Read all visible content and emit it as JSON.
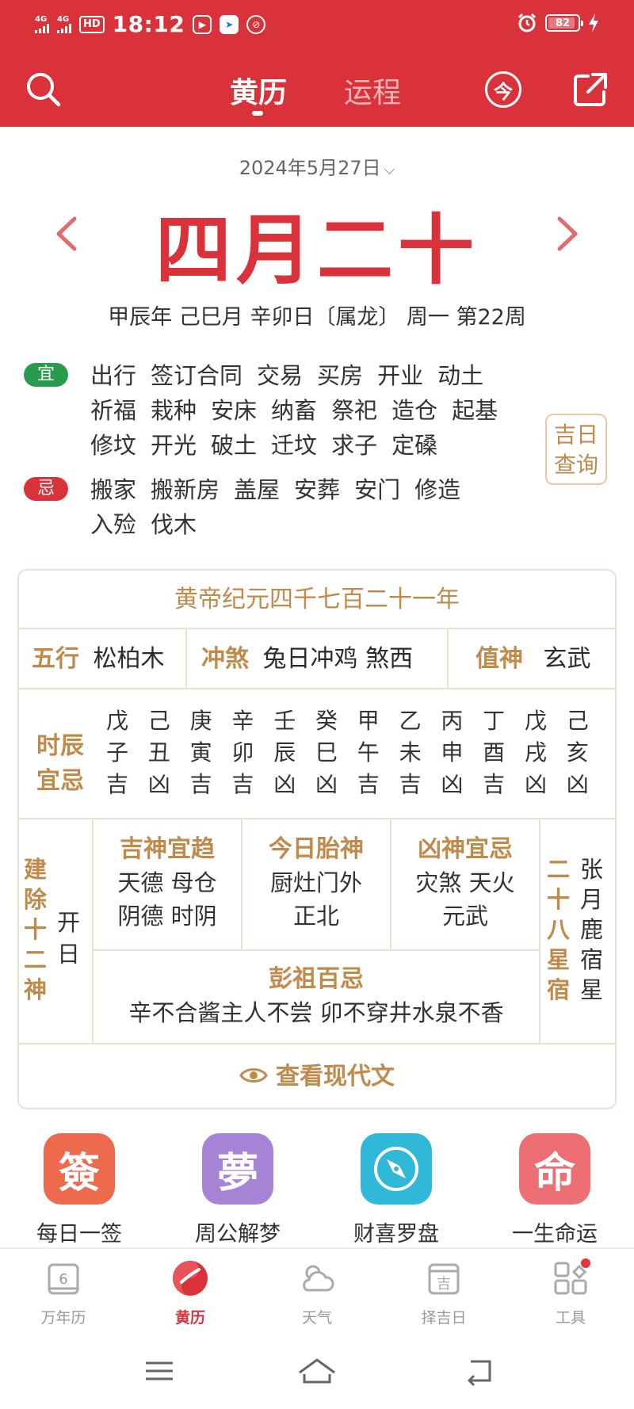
{
  "status_bar": {
    "sig1": "4G",
    "sig2": "4G",
    "hd": "HD",
    "time": "18:12",
    "battery": "82"
  },
  "nav": {
    "tab_huangli": "黄历",
    "tab_yuncheng": "运程",
    "today": "今"
  },
  "date": {
    "solar": "2024年5月27日",
    "lunar": "四月二十",
    "ganzhi": "甲辰年 己巳月 辛卯日〔属龙〕 周一  第22周"
  },
  "yi": {
    "label": "宜",
    "items": [
      "出行",
      "签订合同",
      "交易",
      "买房",
      "开业",
      "动土",
      "祈福",
      "栽种",
      "安床",
      "纳畜",
      "祭祀",
      "造仓",
      "起基",
      "修坟",
      "开光",
      "破土",
      "迁坟",
      "求子",
      "定磉"
    ]
  },
  "ji": {
    "label": "忌",
    "items": [
      "搬家",
      "搬新房",
      "盖屋",
      "安葬",
      "安门",
      "修造",
      "入殓",
      "伐木"
    ]
  },
  "jiri_button": "吉日查询",
  "almanac": {
    "era": "黄帝纪元四千七百二十一年",
    "wuxing_label": "五行",
    "wuxing_value": "松柏木",
    "chongsha_label": "冲煞",
    "chongsha_value": "兔日冲鸡 煞西",
    "zhishen_label": "值神",
    "zhishen_value": "玄武",
    "shichen_label": "时辰宜忌",
    "shichen": [
      {
        "gan": "戊",
        "zhi": "子",
        "luck": "吉"
      },
      {
        "gan": "己",
        "zhi": "丑",
        "luck": "凶"
      },
      {
        "gan": "庚",
        "zhi": "寅",
        "luck": "吉"
      },
      {
        "gan": "辛",
        "zhi": "卯",
        "luck": "吉"
      },
      {
        "gan": "壬",
        "zhi": "辰",
        "luck": "凶"
      },
      {
        "gan": "癸",
        "zhi": "巳",
        "luck": "凶"
      },
      {
        "gan": "甲",
        "zhi": "午",
        "luck": "吉"
      },
      {
        "gan": "乙",
        "zhi": "未",
        "luck": "吉"
      },
      {
        "gan": "丙",
        "zhi": "申",
        "luck": "凶"
      },
      {
        "gan": "丁",
        "zhi": "酉",
        "luck": "吉"
      },
      {
        "gan": "戊",
        "zhi": "戌",
        "luck": "凶"
      },
      {
        "gan": "己",
        "zhi": "亥",
        "luck": "凶"
      }
    ],
    "jianchu_label": "建除十二神",
    "jianchu_value": "开日",
    "jishen_label": "吉神宜趋",
    "jishen_line1": "天德 母仓",
    "jishen_line2": "阴德 时阴",
    "taishen_label": "今日胎神",
    "taishen_line1": "厨灶门外",
    "taishen_line2": "正北",
    "xiongshen_label": "凶神宜忌",
    "xiongshen_line1": "灾煞 天火",
    "xiongshen_line2": "元武",
    "xingxiu_label": "二十八星宿",
    "xingxiu_value": "张月鹿宿星",
    "pengzu_label": "彭祖百忌",
    "pengzu_value": "辛不合酱主人不尝 卯不穿井水泉不香",
    "modern_link": "查看现代文"
  },
  "features": [
    {
      "glyph": "簽",
      "label": "每日一签",
      "color": "#ee6a4e"
    },
    {
      "glyph": "夢",
      "label": "周公解梦",
      "color": "#a783d6"
    },
    {
      "glyph": "",
      "label": "财喜罗盘",
      "color": "#2fb8d8"
    },
    {
      "glyph": "命",
      "label": "一生命运",
      "color": "#ee6f73"
    }
  ],
  "tabbar": {
    "calendar_day": "6",
    "wannianli": "万年历",
    "huangli": "黄历",
    "tianqi": "天气",
    "zejiri": "择吉日",
    "zejiri_glyph": "吉",
    "gongju": "工具"
  },
  "colors": {
    "brand_red": "#d9323a",
    "gold": "#c08a4a",
    "yi_green": "#2a9a4e"
  }
}
